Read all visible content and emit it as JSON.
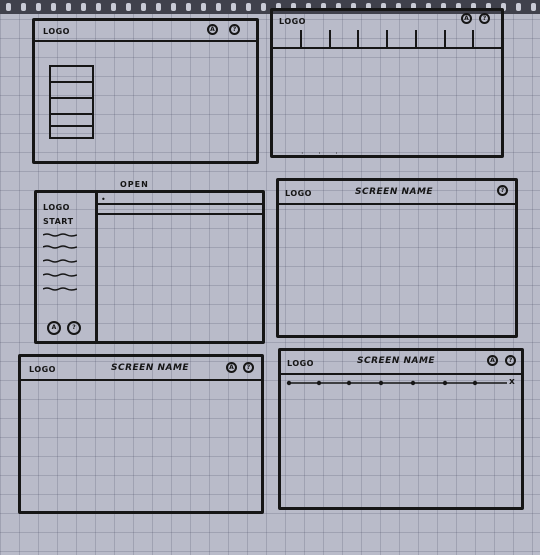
{
  "sketches": [
    {
      "id": "1",
      "logo": "LOGO",
      "icons": [
        "user-icon",
        "help-icon"
      ]
    },
    {
      "id": "2",
      "logo": "LOGO",
      "icons": [
        "user-icon",
        "help-icon"
      ]
    },
    {
      "id": "3",
      "logo": "LOGO",
      "start": "START",
      "open": "OPEN",
      "icons": [
        "user-icon",
        "help-icon"
      ]
    },
    {
      "id": "4",
      "logo": "LOGO",
      "screen_name": "SCREEN NAME",
      "icons": [
        "help-icon"
      ]
    },
    {
      "id": "5",
      "logo": "LOGO",
      "screen_name": "SCREEN NAME",
      "icons": [
        "user-icon",
        "help-icon"
      ]
    },
    {
      "id": "6",
      "logo": "LOGO",
      "screen_name": "SCREEN NAME",
      "icons": [
        "user-icon",
        "help-icon"
      ],
      "progress_end": "x"
    }
  ]
}
